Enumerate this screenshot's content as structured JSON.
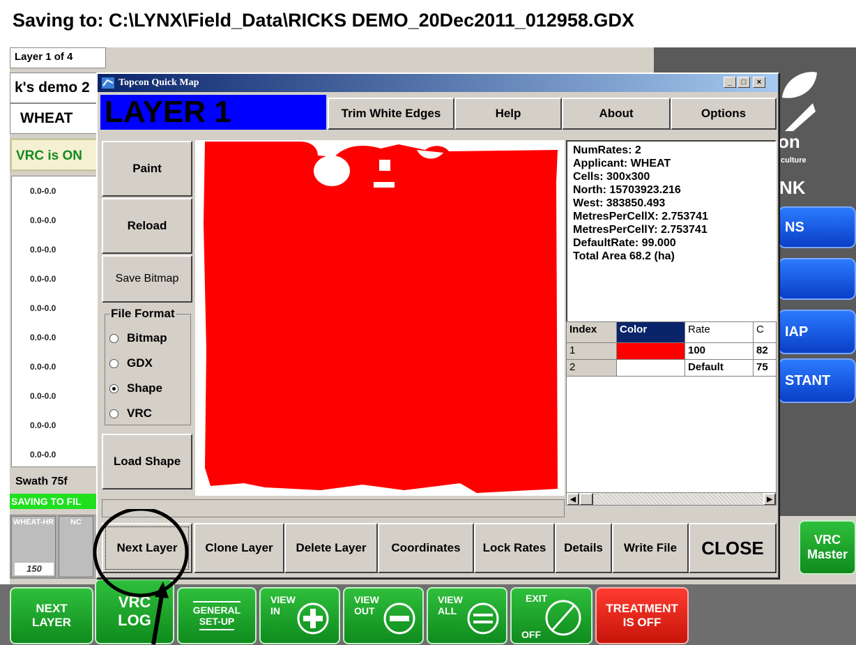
{
  "header": {
    "title": "Saving to: C:\\LYNX\\Field_Data\\RICKS DEMO_20Dec2011_012958.GDX"
  },
  "left_panel": {
    "layer_count": "Layer 1 of 4",
    "demo_name": "k's demo 2",
    "crop": "WHEAT",
    "vrc_status": "VRC is ON",
    "rates": [
      "0.0-0.0",
      "0.0-0.0",
      "0.0-0.0",
      "0.0-0.0",
      "0.0-0.0",
      "0.0-0.0",
      "0.0-0.0",
      "0.0-0.0",
      "0.0-0.0",
      "0.0-0.0"
    ],
    "swath": "Swath 75f",
    "saving_status": "SAVING TO FIL",
    "product_tab1": "WHEAT-HR",
    "product_tab2": "NC",
    "product_value": "150"
  },
  "right_panel": {
    "logo_line1": "on",
    "logo_line2": "culture",
    "logo_line3": "NK",
    "btn1": "NS",
    "btn2": "",
    "btn3": "IAP",
    "btn4": "STANT",
    "vrc_master_line1": "VRC",
    "vrc_master_line2": "Master"
  },
  "dialog": {
    "title": "Topcon Quick Map",
    "layer_label": "LAYER 1",
    "top_buttons": [
      "Trim White Edges",
      "Help",
      "About",
      "Options"
    ],
    "side_buttons": {
      "paint": "Paint",
      "reload": "Reload",
      "save_bitmap": "Save Bitmap",
      "load_shape": "Load Shape"
    },
    "file_format": {
      "legend": "File Format",
      "options": [
        "Bitmap",
        "GDX",
        "Shape",
        "VRC"
      ],
      "selected": "Shape"
    },
    "info_lines": [
      "NumRates: 2",
      "Applicant: WHEAT",
      "Cells: 300x300",
      "North: 15703923.216",
      "West: 383850.493",
      "MetresPerCellX: 2.753741",
      "MetresPerCellY: 2.753741",
      "DefaultRate: 99.000",
      "Total Area 68.2 (ha)"
    ],
    "rate_table": {
      "headers": [
        "Index",
        "Color",
        "Rate",
        "C"
      ],
      "rows": [
        {
          "index": "1",
          "color": "#ff0000",
          "rate": "100",
          "c": "82"
        },
        {
          "index": "2",
          "color": "#ffffff",
          "rate": "Default",
          "c": "75"
        }
      ]
    },
    "bottom_buttons": [
      "Next Layer",
      "Clone Layer",
      "Delete Layer",
      "Coordinates",
      "Lock Rates",
      "Details",
      "Write File"
    ],
    "close_label": "CLOSE",
    "map_color": "#ff0000"
  },
  "bottom_bar": {
    "next_layer": [
      "NEXT",
      "LAYER"
    ],
    "vrc_log": [
      "VRC",
      "LOG"
    ],
    "general_setup": [
      "GENERAL",
      "SET-UP"
    ],
    "view_in": [
      "VIEW",
      "IN"
    ],
    "view_out": [
      "VIEW",
      "OUT"
    ],
    "view_all": [
      "VIEW",
      "ALL"
    ],
    "exit": [
      "EXIT",
      "OFF"
    ],
    "treatment": [
      "TREATMENT",
      "IS OFF"
    ]
  }
}
